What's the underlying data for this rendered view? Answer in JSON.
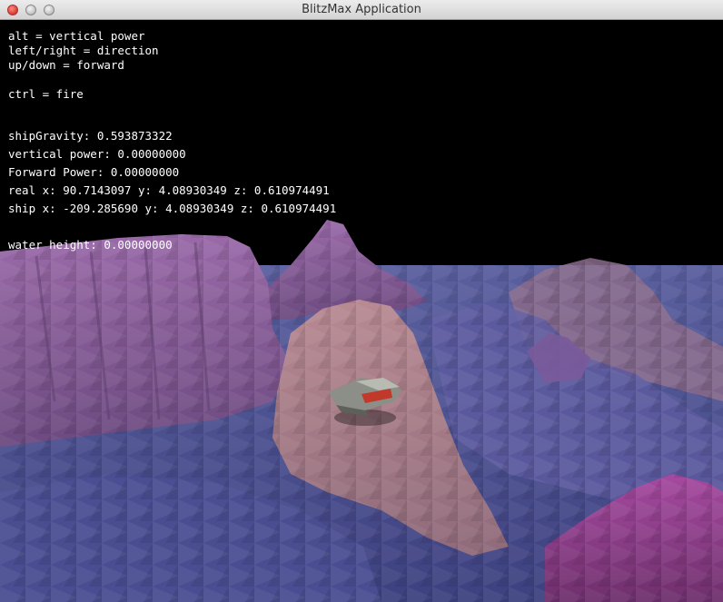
{
  "window": {
    "title": "BlitzMax Application"
  },
  "hud": {
    "controls": [
      "alt = vertical power",
      "left/right = direction",
      "up/down = forward",
      "ctrl = fire"
    ],
    "stats": [
      "shipGravity: 0.593873322",
      "vertical power: 0.00000000",
      "Forward Power: 0.00000000",
      "real x: 90.7143097 y: 4.08930349 z: 0.610974491",
      "ship x: -209.285690 y: 4.08930349 z: 0.610974491",
      "water height: 0.00000000"
    ]
  },
  "colors": {
    "sky": "#000000",
    "terrain_violet": "#8a5f9a",
    "terrain_pink": "#a37a86",
    "water": "#4a4f8c",
    "ship_body": "#8c8f88",
    "ship_accent": "#c0392b"
  }
}
